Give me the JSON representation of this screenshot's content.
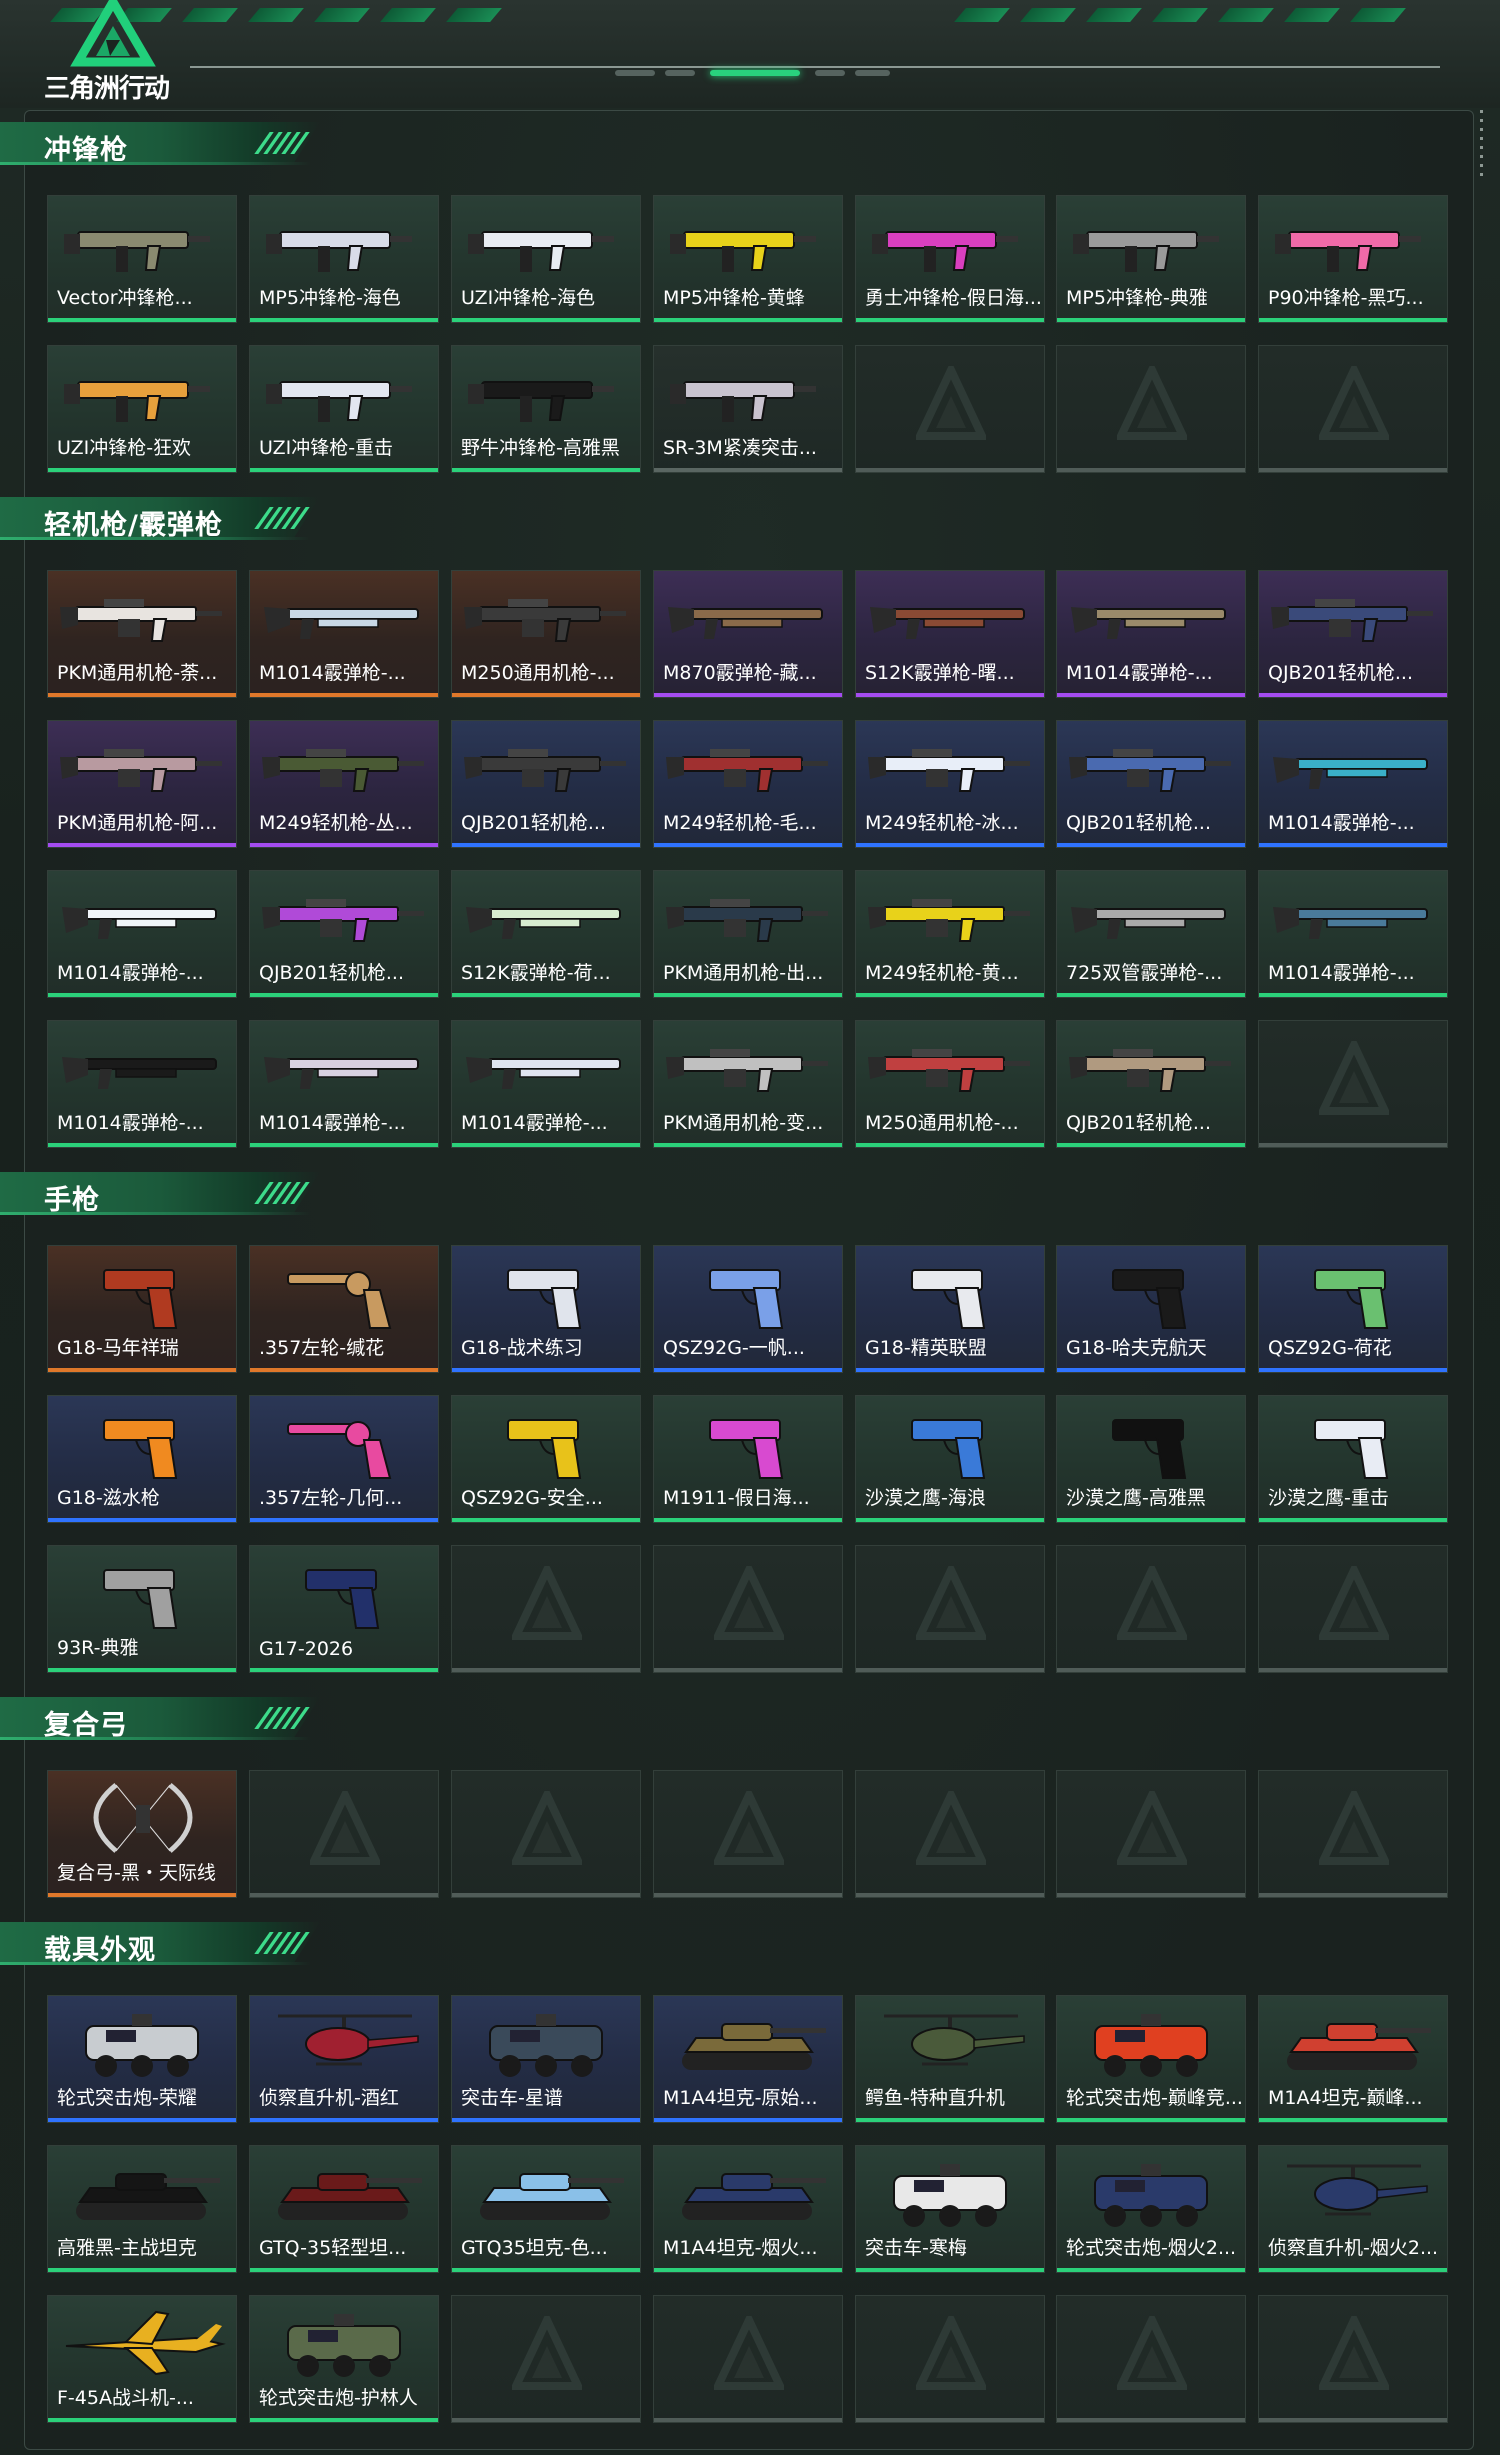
{
  "app": {
    "title": "三角洲行动"
  },
  "sections": [
    {
      "title": "冲锋枪",
      "items": [
        {
          "label": "Vector冲锋枪...",
          "rarity": "green",
          "icon": "smg-icon",
          "color": "#8a8a70"
        },
        {
          "label": "MP5冲锋枪-海色",
          "rarity": "green",
          "icon": "smg-icon",
          "color": "#d8dce8"
        },
        {
          "label": "UZI冲锋枪-海色",
          "rarity": "green",
          "icon": "smg-icon",
          "color": "#e8ecf2"
        },
        {
          "label": "MP5冲锋枪-黄蜂",
          "rarity": "green",
          "icon": "smg-icon",
          "color": "#e8d21a"
        },
        {
          "label": "勇士冲锋枪-假日海...",
          "rarity": "green",
          "icon": "smg-icon",
          "color": "#d93fbf"
        },
        {
          "label": "MP5冲锋枪-典雅",
          "rarity": "green",
          "icon": "smg-icon",
          "color": "#9a9a9a"
        },
        {
          "label": "P90冲锋枪-黑巧...",
          "rarity": "green",
          "icon": "smg-icon",
          "color": "#f06aa8"
        },
        {
          "label": "UZI冲锋枪-狂欢",
          "rarity": "green",
          "icon": "smg-icon",
          "color": "#e7a03c"
        },
        {
          "label": "UZI冲锋枪-重击",
          "rarity": "green",
          "icon": "smg-icon",
          "color": "#e2e6f0"
        },
        {
          "label": "野牛冲锋枪-高雅黑",
          "rarity": "green",
          "icon": "smg-icon",
          "color": "#1a1a1a"
        },
        {
          "label": "SR-3M紧凑突击...",
          "rarity": "grey",
          "icon": "smg-icon",
          "color": "#c9c3cf"
        },
        {
          "empty": true
        },
        {
          "empty": true
        },
        {
          "empty": true
        }
      ]
    },
    {
      "title": "轻机枪/霰弹枪",
      "items": [
        {
          "label": "PKM通用机枪-荼...",
          "rarity": "orange",
          "icon": "lmg-icon",
          "color": "#e8e4e0"
        },
        {
          "label": "M1014霰弹枪-...",
          "rarity": "orange",
          "icon": "shotgun-icon",
          "color": "#c8d8e6"
        },
        {
          "label": "M250通用机枪-...",
          "rarity": "orange",
          "icon": "lmg-icon",
          "color": "#3a3a3a"
        },
        {
          "label": "M870霰弹枪-藏...",
          "rarity": "purple",
          "icon": "shotgun-icon",
          "color": "#8a6a4a"
        },
        {
          "label": "S12K霰弹枪-曙...",
          "rarity": "purple",
          "icon": "shotgun-icon",
          "color": "#8a4a34"
        },
        {
          "label": "M1014霰弹枪-...",
          "rarity": "purple",
          "icon": "shotgun-icon",
          "color": "#9a8a6a"
        },
        {
          "label": "QJB201轻机枪...",
          "rarity": "purple",
          "icon": "lmg-icon",
          "color": "#3a4a7a"
        },
        {
          "label": "PKM通用机枪-阿...",
          "rarity": "purple",
          "icon": "lmg-icon",
          "color": "#b89aa0"
        },
        {
          "label": "M249轻机枪-丛...",
          "rarity": "purple",
          "icon": "lmg-icon",
          "color": "#4a5a34"
        },
        {
          "label": "QJB201轻机枪...",
          "rarity": "blue",
          "icon": "lmg-icon",
          "color": "#3a3a3a"
        },
        {
          "label": "M249轻机枪-毛...",
          "rarity": "blue",
          "icon": "lmg-icon",
          "color": "#a03030"
        },
        {
          "label": "M249轻机枪-冰...",
          "rarity": "blue",
          "icon": "lmg-icon",
          "color": "#e8eef8"
        },
        {
          "label": "QJB201轻机枪...",
          "rarity": "blue",
          "icon": "lmg-icon",
          "color": "#4a6ab0"
        },
        {
          "label": "M1014霰弹枪-...",
          "rarity": "blue",
          "icon": "shotgun-icon",
          "color": "#3ab0c8"
        },
        {
          "label": "M1014霰弹枪-...",
          "rarity": "green",
          "icon": "shotgun-icon",
          "color": "#f0f4f8"
        },
        {
          "label": "QJB201轻机枪...",
          "rarity": "green",
          "icon": "lmg-icon",
          "color": "#b04ad8"
        },
        {
          "label": "S12K霰弹枪-荷...",
          "rarity": "green",
          "icon": "shotgun-icon",
          "color": "#d8ecd0"
        },
        {
          "label": "PKM通用机枪-出...",
          "rarity": "green",
          "icon": "lmg-icon",
          "color": "#2a3a4a"
        },
        {
          "label": "M249轻机枪-黄...",
          "rarity": "green",
          "icon": "lmg-icon",
          "color": "#e8d21a"
        },
        {
          "label": "725双管霰弹枪-...",
          "rarity": "green",
          "icon": "shotgun-icon",
          "color": "#aaaaaa"
        },
        {
          "label": "M1014霰弹枪-...",
          "rarity": "green",
          "icon": "shotgun-icon",
          "color": "#4a7a9a"
        },
        {
          "label": "M1014霰弹枪-...",
          "rarity": "green",
          "icon": "shotgun-icon",
          "color": "#1a1a1a"
        },
        {
          "label": "M1014霰弹枪-...",
          "rarity": "green",
          "icon": "shotgun-icon",
          "color": "#d8d0e0"
        },
        {
          "label": "M1014霰弹枪-...",
          "rarity": "green",
          "icon": "shotgun-icon",
          "color": "#e0e4f0"
        },
        {
          "label": "PKM通用机枪-变...",
          "rarity": "green",
          "icon": "lmg-icon",
          "color": "#c0c0c0"
        },
        {
          "label": "M250通用机枪-...",
          "rarity": "green",
          "icon": "lmg-icon",
          "color": "#c04040"
        },
        {
          "label": "QJB201轻机枪...",
          "rarity": "green",
          "icon": "lmg-icon",
          "color": "#b09a80"
        },
        {
          "empty": true
        }
      ]
    },
    {
      "title": "手枪",
      "items": [
        {
          "label": "G18-马年祥瑞",
          "rarity": "orange",
          "icon": "pistol-icon",
          "color": "#b03a20"
        },
        {
          "label": ".357左轮-缄花",
          "rarity": "orange",
          "icon": "revolver-icon",
          "color": "#c89a60"
        },
        {
          "label": "G18-战术练习",
          "rarity": "blue",
          "icon": "pistol-icon",
          "color": "#e0e4ec"
        },
        {
          "label": "QSZ92G-一帆...",
          "rarity": "blue",
          "icon": "pistol-icon",
          "color": "#7aa0e8"
        },
        {
          "label": "G18-精英联盟",
          "rarity": "blue",
          "icon": "pistol-icon",
          "color": "#e8eaee"
        },
        {
          "label": "G18-哈夫克航天",
          "rarity": "blue",
          "icon": "pistol-icon",
          "color": "#1a1a1a"
        },
        {
          "label": "QSZ92G-荷花",
          "rarity": "blue",
          "icon": "pistol-icon",
          "color": "#6ac070"
        },
        {
          "label": "G18-滋水枪",
          "rarity": "blue",
          "icon": "pistol-icon",
          "color": "#f08a20"
        },
        {
          "label": ".357左轮-几何...",
          "rarity": "blue",
          "icon": "revolver-icon",
          "color": "#e84aa0"
        },
        {
          "label": "QSZ92G-安全...",
          "rarity": "green",
          "icon": "pistol-icon",
          "color": "#e8c21a"
        },
        {
          "label": "M1911-假日海...",
          "rarity": "green",
          "icon": "pistol-icon",
          "color": "#d84ad0"
        },
        {
          "label": "沙漠之鹰-海浪",
          "rarity": "green",
          "icon": "pistol-icon",
          "color": "#3a7ad8"
        },
        {
          "label": "沙漠之鹰-高雅黑",
          "rarity": "green",
          "icon": "pistol-icon",
          "color": "#111111"
        },
        {
          "label": "沙漠之鹰-重击",
          "rarity": "green",
          "icon": "pistol-icon",
          "color": "#e8ecf4"
        },
        {
          "label": "93R-典雅",
          "rarity": "green",
          "icon": "pistol-icon",
          "color": "#a0a0a0"
        },
        {
          "label": "G17-2026",
          "rarity": "green",
          "icon": "pistol-icon",
          "color": "#22306a"
        },
        {
          "empty": true
        },
        {
          "empty": true
        },
        {
          "empty": true
        },
        {
          "empty": true
        },
        {
          "empty": true
        }
      ]
    },
    {
      "title": "复合弓",
      "items": [
        {
          "label": "复合弓-黑・天际线",
          "rarity": "orange",
          "icon": "bow-icon",
          "color": "#d0d0d0"
        },
        {
          "empty": true
        },
        {
          "empty": true
        },
        {
          "empty": true
        },
        {
          "empty": true
        },
        {
          "empty": true
        },
        {
          "empty": true
        }
      ]
    },
    {
      "title": "载具外观",
      "items": [
        {
          "label": "轮式突击炮-荣耀",
          "rarity": "blue",
          "icon": "armored-car-icon",
          "color": "#c8ccd0"
        },
        {
          "label": "侦察直升机-酒红",
          "rarity": "blue",
          "icon": "helicopter-icon",
          "color": "#a02030"
        },
        {
          "label": "突击车-星谱",
          "rarity": "blue",
          "icon": "armored-car-icon",
          "color": "#3a4a5a"
        },
        {
          "label": "M1A4坦克-原始...",
          "rarity": "blue",
          "icon": "tank-icon",
          "color": "#7a6a3a"
        },
        {
          "label": "鳄鱼-特种直升机",
          "rarity": "green",
          "icon": "helicopter-icon",
          "color": "#4a5a3a"
        },
        {
          "label": "轮式突击炮-巅峰竞...",
          "rarity": "green",
          "icon": "armored-car-icon",
          "color": "#e04020"
        },
        {
          "label": "M1A4坦克-巅峰...",
          "rarity": "green",
          "icon": "tank-icon",
          "color": "#d04030"
        },
        {
          "label": "高雅黑-主战坦克",
          "rarity": "green",
          "icon": "tank-icon",
          "color": "#151515"
        },
        {
          "label": "GTQ-35轻型坦...",
          "rarity": "green",
          "icon": "tank-icon",
          "color": "#6a1a1a"
        },
        {
          "label": "GTQ35坦克-色...",
          "rarity": "green",
          "icon": "tank-icon",
          "color": "#8ac0e8"
        },
        {
          "label": "M1A4坦克-烟火...",
          "rarity": "green",
          "icon": "tank-icon",
          "color": "#2a3a6a"
        },
        {
          "label": "突击车-寒梅",
          "rarity": "green",
          "icon": "armored-car-icon",
          "color": "#e8e8e8"
        },
        {
          "label": "轮式突击炮-烟火2...",
          "rarity": "green",
          "icon": "armored-car-icon",
          "color": "#2a3a6a"
        },
        {
          "label": "侦察直升机-烟火2...",
          "rarity": "green",
          "icon": "helicopter-icon",
          "color": "#2a3a6a"
        },
        {
          "label": "F-45A战斗机-...",
          "rarity": "green",
          "icon": "jet-icon",
          "color": "#e8b020"
        },
        {
          "label": "轮式突击炮-护林人",
          "rarity": "green",
          "icon": "armored-car-icon",
          "color": "#5a6a4a"
        },
        {
          "empty": true
        },
        {
          "empty": true
        },
        {
          "empty": true
        },
        {
          "empty": true
        },
        {
          "empty": true
        }
      ]
    }
  ]
}
